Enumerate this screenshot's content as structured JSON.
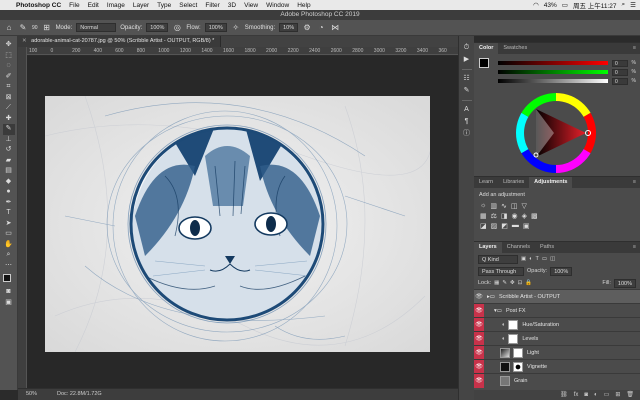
{
  "menubar": {
    "apple": "",
    "items": [
      "Photoshop CC",
      "File",
      "Edit",
      "Image",
      "Layer",
      "Type",
      "Select",
      "Filter",
      "3D",
      "View",
      "Window",
      "Help"
    ],
    "battery": "43%",
    "clock": "周五 上午11:27"
  },
  "titlebar": {
    "title": "Adobe Photoshop CC 2019"
  },
  "options": {
    "brush_size": "90",
    "mode_label": "Mode:",
    "mode_value": "Normal",
    "opacity_label": "Opacity:",
    "opacity_value": "100%",
    "flow_label": "Flow:",
    "flow_value": "100%",
    "smoothing_label": "Smoothing:",
    "smoothing_value": "10%"
  },
  "document": {
    "tab_title": "adorable-animal-cat-20787.jpg @ 50% (Scribble Artist - OUTPUT, RGB/8) *",
    "ruler_ticks": [
      "100",
      "0",
      "200",
      "400",
      "600",
      "800",
      "1000",
      "1200",
      "1400",
      "1600",
      "1800",
      "2000",
      "2200",
      "2400",
      "2600",
      "2800",
      "3000",
      "3200",
      "3400",
      "360"
    ]
  },
  "status": {
    "zoom": "50%",
    "doc": "Doc: 22.8M/1.72G"
  },
  "color_panel": {
    "tabs": [
      "Color",
      "Swatches"
    ],
    "values": [
      "0",
      "0",
      "0"
    ],
    "pct": "%",
    "hue_color": "#e8202a"
  },
  "adjustments_panel": {
    "tabs": [
      "Learn",
      "Libraries",
      "Adjustments"
    ],
    "hint": "Add an adjustment"
  },
  "layers_panel": {
    "tabs": [
      "Layers",
      "Channels",
      "Paths"
    ],
    "kind": "Q Kind",
    "blend": "Pass Through",
    "opacity_label": "Opacity:",
    "opacity_value": "100%",
    "lock_label": "Lock:",
    "fill_label": "Fill:",
    "fill_value": "100%",
    "layers": [
      {
        "name": "Scribble Artist - OUTPUT"
      },
      {
        "name": "Post FX"
      },
      {
        "name": "Hue/Saturation"
      },
      {
        "name": "Levels"
      },
      {
        "name": "Light"
      },
      {
        "name": "Vignette"
      },
      {
        "name": "Grain"
      }
    ]
  }
}
